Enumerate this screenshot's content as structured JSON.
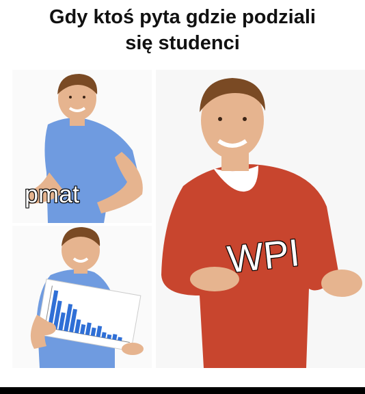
{
  "caption": {
    "line1": "Gdy ktoś pyta gdzie podziali",
    "line2": "się studenci"
  },
  "panels": {
    "top_left": {
      "label": "pmat"
    },
    "bottom_left": {
      "label": ""
    },
    "right": {
      "label": "WPI"
    }
  },
  "colors": {
    "blue_shirt": "#6f9be0",
    "red_sweater": "#c8452e",
    "skin": "#e6b48f",
    "hair": "#7a4a24",
    "chart_bar": "#2f6fd6",
    "background": "#ffffff"
  }
}
